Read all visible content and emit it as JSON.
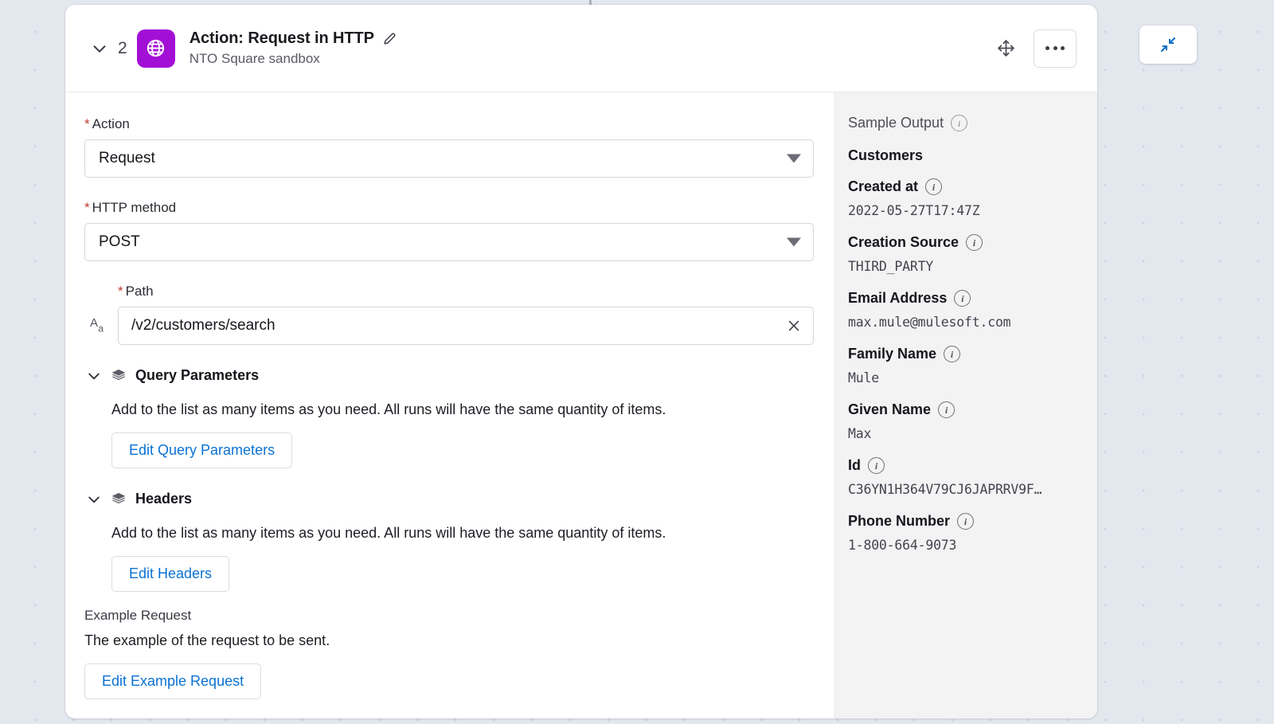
{
  "header": {
    "step_number": "2",
    "title": "Action: Request in HTTP",
    "subtitle": "NTO Square sandbox",
    "collapse_chevron_icon": "chevron-down-icon",
    "app_icon": "globe-icon",
    "edit_icon": "pencil-icon",
    "move_icon": "move-handle-icon",
    "more_icon": "ellipsis-icon",
    "accent_purple": "#a210d6"
  },
  "toolbar": {
    "collapse_all_icon": "collapse-arrows-icon",
    "collapse_all_color": "#1071c9"
  },
  "form": {
    "action": {
      "label": "Action",
      "required_marker": "*",
      "value": "Request"
    },
    "http_method": {
      "label": "HTTP method",
      "required_marker": "*",
      "value": "POST"
    },
    "path": {
      "label": "Path",
      "required_marker": "*",
      "value": "/v2/customers/search",
      "type_icon": "text-format-icon",
      "clear_icon": "close-icon"
    },
    "query_parameters": {
      "title": "Query Parameters",
      "icon": "layers-icon",
      "chevron": "chevron-down-icon",
      "description": "Add to the list as many items as you need. All runs will have the same quantity of items.",
      "button_label": "Edit Query Parameters"
    },
    "headers": {
      "title": "Headers",
      "icon": "layers-icon",
      "chevron": "chevron-down-icon",
      "description": "Add to the list as many items as you need. All runs will have the same quantity of items.",
      "button_label": "Edit Headers"
    },
    "example_request": {
      "label": "Example Request",
      "description": "The example of the request to be sent.",
      "button_label": "Edit Example Request"
    }
  },
  "sample_output": {
    "title": "Sample Output",
    "info_icon": "info-icon",
    "object_name": "Customers",
    "fields": [
      {
        "key": "Created at",
        "value": "2022-05-27T17:47Z"
      },
      {
        "key": "Creation Source",
        "value": "THIRD_PARTY"
      },
      {
        "key": "Email Address",
        "value": "max.mule@mulesoft.com"
      },
      {
        "key": "Family Name",
        "value": "Mule"
      },
      {
        "key": "Given Name",
        "value": "Max"
      },
      {
        "key": "Id",
        "value": "C36YN1H364V79CJ6JAPRRV9F…"
      },
      {
        "key": "Phone Number",
        "value": "1-800-664-9073"
      }
    ]
  }
}
